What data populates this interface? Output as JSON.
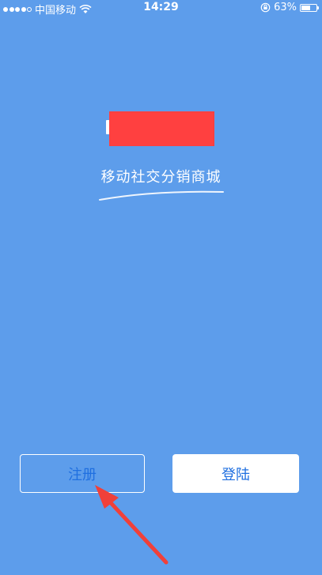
{
  "status_bar": {
    "carrier": "中国移动",
    "time": "14:29",
    "battery_text": "63%",
    "battery_level": 0.63,
    "wifi_icon": "wifi-icon",
    "rotation_lock_icon": "rotation-lock-icon"
  },
  "branding": {
    "logo_redacted": true,
    "slogan": "移动社交分销商城"
  },
  "actions": {
    "register_label": "注册",
    "login_label": "登陆"
  },
  "colors": {
    "background": "#5d9deb",
    "redaction": "#ff4040",
    "button_text": "#1f6fe0",
    "arrow": "#f0403a"
  }
}
